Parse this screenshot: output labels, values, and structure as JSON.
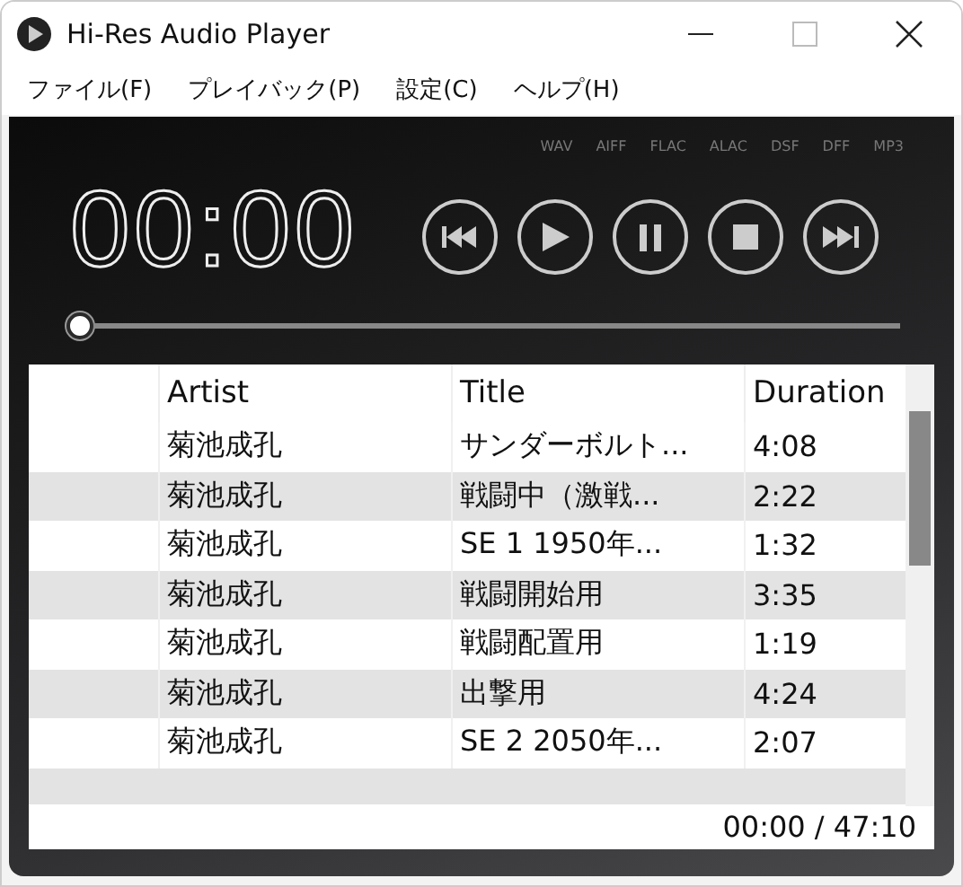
{
  "window": {
    "title": "Hi-Res Audio Player"
  },
  "menu": [
    "ファイル(F)",
    "プレイバック(P)",
    "設定(C)",
    "ヘルプ(H)"
  ],
  "formats": [
    "WAV",
    "AIFF",
    "FLAC",
    "ALAC",
    "DSF",
    "DFF",
    "MP3"
  ],
  "time_display": "00:00",
  "transport_buttons": [
    {
      "kind": "previous"
    },
    {
      "kind": "play"
    },
    {
      "kind": "pause"
    },
    {
      "kind": "stop"
    },
    {
      "kind": "next"
    }
  ],
  "seek": {
    "level": 0
  },
  "table": {
    "columns": [
      "Artist",
      "Title",
      "Duration"
    ],
    "rows": [
      {
        "artist": "菊池成孔",
        "title": "サンダーボルト...",
        "duration": "4:08"
      },
      {
        "artist": "菊池成孔",
        "title": "戦闘中（激戦...",
        "duration": "2:22"
      },
      {
        "artist": "菊池成孔",
        "title": "SE 1 1950年...",
        "duration": "1:32"
      },
      {
        "artist": "菊池成孔",
        "title": "戦闘開始用",
        "duration": "3:35"
      },
      {
        "artist": "菊池成孔",
        "title": "戦闘配置用",
        "duration": "1:19"
      },
      {
        "artist": "菊池成孔",
        "title": "出撃用",
        "duration": "4:24"
      },
      {
        "artist": "菊池成孔",
        "title": "SE 2 2050年...",
        "duration": "2:07"
      }
    ]
  },
  "status": "00:00 / 47:10"
}
